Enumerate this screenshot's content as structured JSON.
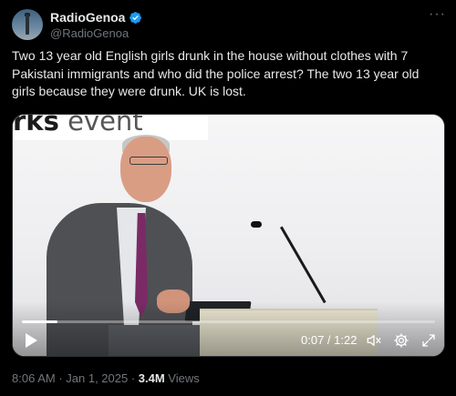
{
  "author": {
    "display_name": "RadioGenoa",
    "handle": "@RadioGenoa",
    "verified": true,
    "avatar": "lighthouse-avatar",
    "accent": "#1d9bf0"
  },
  "more_icon": "more-horizontal-icon",
  "tweet": {
    "text": "Two 13 year old English girls drunk in the house without clothes with 7 Pakistani immigrants and who did the police arrest? The two 13 year old girls because they were drunk. UK is lost."
  },
  "video": {
    "banner_bold": "rks",
    "banner_text": " event",
    "time_display": "0:07 / 1:22",
    "progress": 0.085,
    "icons": {
      "play": "play-icon",
      "mute": "mute-icon",
      "settings": "gear-icon",
      "fullscreen": "expand-icon"
    }
  },
  "meta": {
    "time": "8:06 AM",
    "separator": " · ",
    "date": "Jan 1, 2025",
    "views_count": "3.4M",
    "views_label": " Views"
  },
  "colors": {
    "background": "#000000",
    "text": "#e7e9ea",
    "secondary": "#71767b"
  }
}
